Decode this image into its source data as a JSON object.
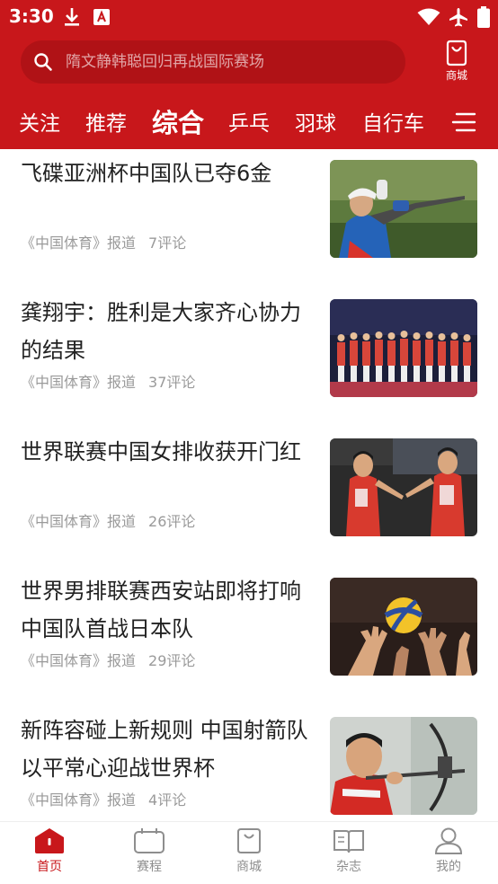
{
  "status_bar": {
    "time": "3:30",
    "icons": [
      "download-icon",
      "app-notification-icon",
      "wifi-icon",
      "airplane-mode-icon",
      "battery-icon"
    ]
  },
  "search": {
    "placeholder": "隋文静韩聪回归再战国际赛场"
  },
  "mall_button": {
    "label": "商城",
    "icon": "shopping-bag-icon"
  },
  "tabs": [
    {
      "label": "关注",
      "active": false
    },
    {
      "label": "推荐",
      "active": false
    },
    {
      "label": "综合",
      "active": true
    },
    {
      "label": "乒乓",
      "active": false
    },
    {
      "label": "羽球",
      "active": false
    },
    {
      "label": "自行车",
      "active": false
    }
  ],
  "articles": [
    {
      "title": "飞碟亚洲杯中国队已夺6金",
      "source": "《中国体育》报道",
      "comments": "7评论",
      "image": "shooting-athlete-photo"
    },
    {
      "title": "龚翔宇：胜利是大家齐心协力的结果",
      "source": "《中国体育》报道",
      "comments": "37评论",
      "image": "volleyball-team-lineup-photo"
    },
    {
      "title": "世界联赛中国女排收获开门红",
      "source": "《中国体育》报道",
      "comments": "26评论",
      "image": "volleyball-players-celebrating-photo"
    },
    {
      "title": "世界男排联赛西安站即将打响中国队首战日本队",
      "source": "《中国体育》报道",
      "comments": "29评论",
      "image": "volleyball-block-photo"
    },
    {
      "title": "新阵容碰上新规则 中国射箭队以平常心迎战世界杯",
      "source": "《中国体育》报道",
      "comments": "4评论",
      "image": "archer-aiming-photo"
    }
  ],
  "bottom_nav": [
    {
      "label": "首页",
      "icon": "home-icon",
      "active": true
    },
    {
      "label": "赛程",
      "icon": "schedule-icon",
      "active": false
    },
    {
      "label": "商城",
      "icon": "shopping-bag-icon",
      "active": false
    },
    {
      "label": "杂志",
      "icon": "magazine-book-icon",
      "active": false
    },
    {
      "label": "我的",
      "icon": "profile-icon",
      "active": false
    }
  ],
  "colors": {
    "brand_red": "#c8171b",
    "search_bg": "#b01216",
    "meta_gray": "#9a9a9a",
    "nav_inactive": "#8e8e8e"
  }
}
